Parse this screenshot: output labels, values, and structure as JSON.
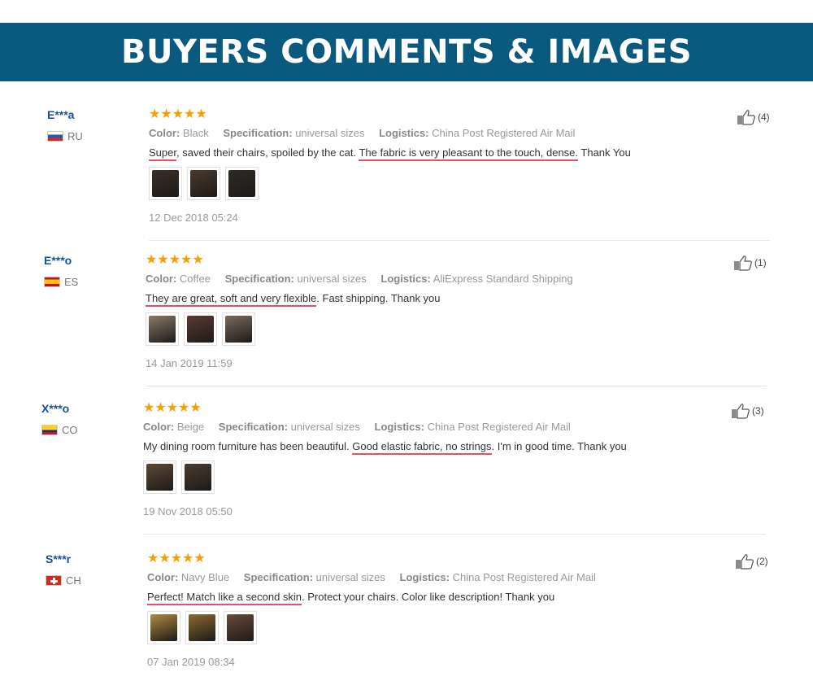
{
  "banner": {
    "title": "BUYERS COMMENTS & IMAGES"
  },
  "labels": {
    "color": "Color:",
    "specification": "Specification:",
    "logistics": "Logistics:"
  },
  "reviews": [
    {
      "buyer": "E***a",
      "country": "RU",
      "stars": "★★★★★",
      "color": "Black",
      "specification": "universal sizes",
      "logistics": "China Post Registered Air Mail",
      "comment": {
        "p1": "Super",
        "p2": ", saved their chairs, spoiled by the cat. ",
        "p3": "The fabric is very pleasant to the touch, dense.",
        "p4": " Thank You"
      },
      "date": "12 Dec 2018 05:24",
      "likes": "(4)",
      "images": [
        "#3a2e28",
        "#4a3a2c",
        "#2e2a26"
      ]
    },
    {
      "buyer": "E***o",
      "country": "ES",
      "stars": "★★★★★",
      "color": "Coffee",
      "specification": "universal sizes",
      "logistics": "AliExpress Standard Shipping",
      "comment": {
        "p1": "They are great, soft and very flexible",
        "p2": ". Fast shipping. Thank you",
        "p3": "",
        "p4": ""
      },
      "date": "14 Jan 2019 11:59",
      "likes": "(1)",
      "images": [
        "#8a7a6a",
        "#5a3a34",
        "#7a6a5c"
      ]
    },
    {
      "buyer": "X***o",
      "country": "CO",
      "stars": "★★★★★",
      "color": "Beige",
      "specification": "universal sizes",
      "logistics": "China Post Registered Air Mail",
      "comment": {
        "p1": "",
        "p2": "My dining room furniture has been beautiful. ",
        "p3": "Good elastic fabric, no strings",
        "p4": ". I'm in good time. Thank you"
      },
      "date": "19 Nov 2018 05:50",
      "likes": "(3)",
      "images": [
        "#5c4a38",
        "#4a3c30"
      ]
    },
    {
      "buyer": "S***r",
      "country": "CH",
      "stars": "★★★★★",
      "color": "Navy Blue",
      "specification": "universal sizes",
      "logistics": "China Post Registered Air Mail",
      "comment": {
        "p1": "Perfect! Match like a second skin",
        "p2": ". Protect your chairs. Color like description! Thank you",
        "p3": "",
        "p4": ""
      },
      "date": "07 Jan 2019 08:34",
      "likes": "(2)",
      "images": [
        "#b08a40",
        "#8a6a30",
        "#6a4a3a"
      ]
    }
  ]
}
